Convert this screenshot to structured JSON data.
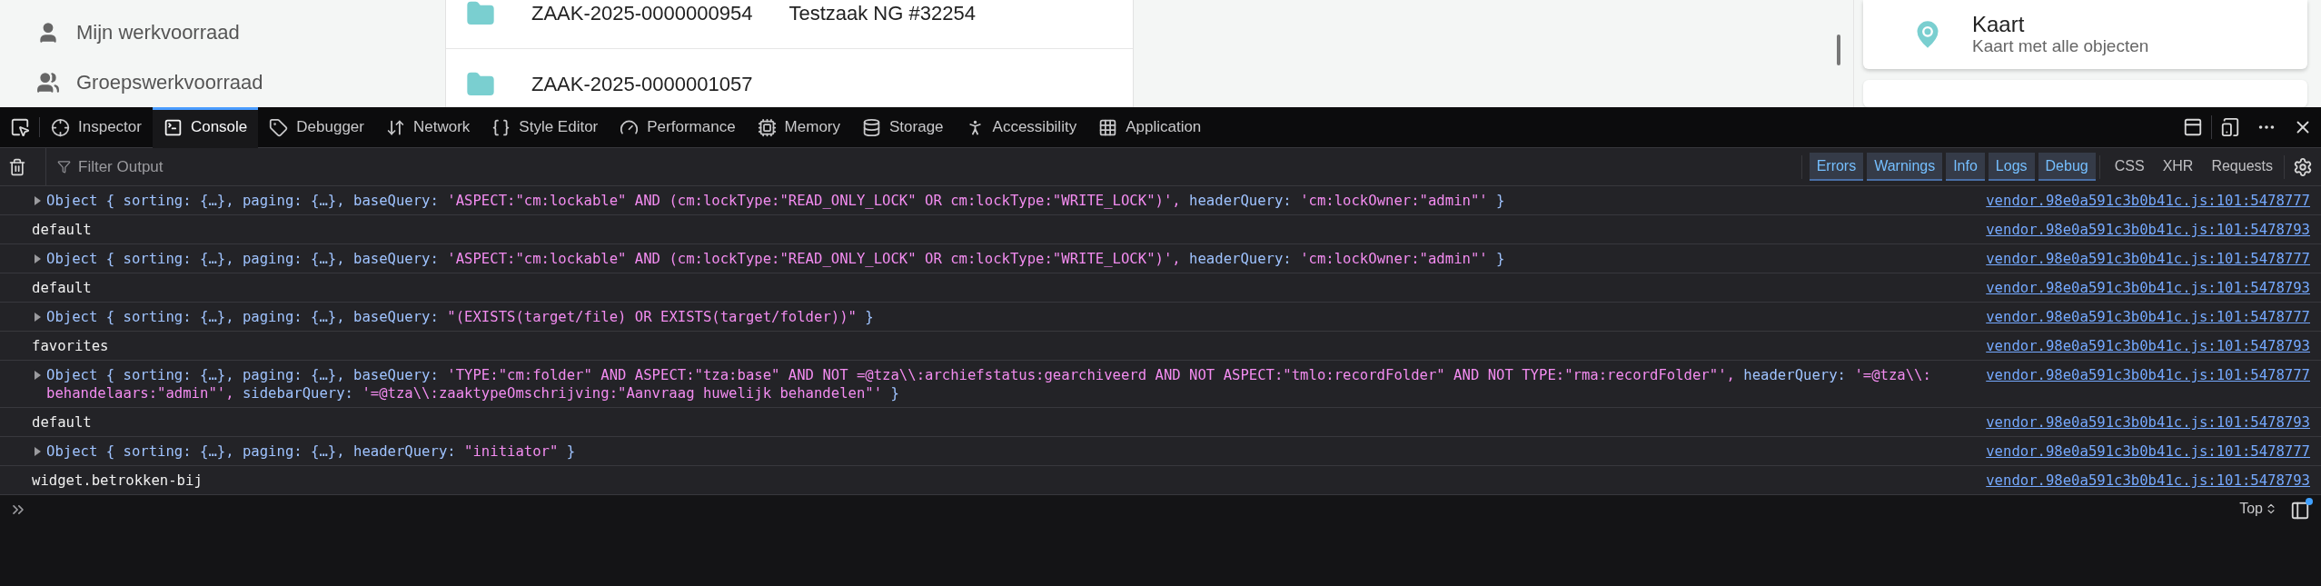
{
  "sidebar": {
    "items": [
      {
        "label": "Mijn werkvoorraad"
      },
      {
        "label": "Groepswerkvoorraad"
      }
    ]
  },
  "cases": [
    {
      "number": "ZAAK-2025-0000000954",
      "title": "Testzaak NG #32254"
    },
    {
      "number": "ZAAK-2025-0000001057"
    }
  ],
  "card": {
    "title": "Kaart",
    "subtitle": "Kaart met alle objecten"
  },
  "devtools": {
    "tabs": [
      {
        "label": "Inspector",
        "selected": false
      },
      {
        "label": "Console",
        "selected": true
      },
      {
        "label": "Debugger",
        "selected": false
      },
      {
        "label": "Network",
        "selected": false
      },
      {
        "label": "Style Editor",
        "selected": false
      },
      {
        "label": "Performance",
        "selected": false
      },
      {
        "label": "Memory",
        "selected": false
      },
      {
        "label": "Storage",
        "selected": false
      },
      {
        "label": "Accessibility",
        "selected": false
      },
      {
        "label": "Application",
        "selected": false
      }
    ],
    "filter": {
      "placeholder": "Filter Output"
    },
    "levels": [
      {
        "label": "Errors",
        "selected": true
      },
      {
        "label": "Warnings",
        "selected": true
      },
      {
        "label": "Info",
        "selected": true
      },
      {
        "label": "Logs",
        "selected": true
      },
      {
        "label": "Debug",
        "selected": true
      }
    ],
    "categories": [
      {
        "label": "CSS",
        "selected": false
      },
      {
        "label": "XHR",
        "selected": false
      },
      {
        "label": "Requests",
        "selected": false
      }
    ],
    "messages": [
      {
        "kind": "object",
        "open": "Object {",
        "props": [
          {
            "key": "sorting:",
            "value": "{…},",
            "kind": "ref"
          },
          {
            "key": "paging:",
            "value": "{…},",
            "kind": "ref"
          },
          {
            "key": "baseQuery:",
            "value": "'ASPECT:\"cm:lockable\" AND (cm:lockType:\"READ_ONLY_LOCK\" OR cm:lockType:\"WRITE_LOCK\")',",
            "kind": "string"
          },
          {
            "key": "headerQuery:",
            "value": "'cm:lockOwner:\"admin\"'",
            "kind": "string"
          }
        ],
        "close": "}",
        "source": "vendor.98e0a591c3b0b41c.js:101:5478777"
      },
      {
        "kind": "text",
        "text": "default",
        "source": "vendor.98e0a591c3b0b41c.js:101:5478793"
      },
      {
        "kind": "object",
        "open": "Object {",
        "props": [
          {
            "key": "sorting:",
            "value": "{…},",
            "kind": "ref"
          },
          {
            "key": "paging:",
            "value": "{…},",
            "kind": "ref"
          },
          {
            "key": "baseQuery:",
            "value": "'ASPECT:\"cm:lockable\" AND (cm:lockType:\"READ_ONLY_LOCK\" OR cm:lockType:\"WRITE_LOCK\")',",
            "kind": "string"
          },
          {
            "key": "headerQuery:",
            "value": "'cm:lockOwner:\"admin\"'",
            "kind": "string"
          }
        ],
        "close": "}",
        "source": "vendor.98e0a591c3b0b41c.js:101:5478777"
      },
      {
        "kind": "text",
        "text": "default",
        "source": "vendor.98e0a591c3b0b41c.js:101:5478793"
      },
      {
        "kind": "object",
        "open": "Object {",
        "props": [
          {
            "key": "sorting:",
            "value": "{…},",
            "kind": "ref"
          },
          {
            "key": "paging:",
            "value": "{…},",
            "kind": "ref"
          },
          {
            "key": "baseQuery:",
            "value": "\"(EXISTS(target/file) OR EXISTS(target/folder))\"",
            "kind": "string"
          }
        ],
        "close": "}",
        "source": "vendor.98e0a591c3b0b41c.js:101:5478777"
      },
      {
        "kind": "text",
        "text": "favorites",
        "source": "vendor.98e0a591c3b0b41c.js:101:5478793"
      },
      {
        "kind": "object",
        "open": "Object {",
        "props": [
          {
            "key": "sorting:",
            "value": "{…},",
            "kind": "ref"
          },
          {
            "key": "paging:",
            "value": "{…},",
            "kind": "ref"
          },
          {
            "key": "baseQuery:",
            "value": "'TYPE:\"cm:folder\" AND ASPECT:\"tza:base\" AND NOT =@tza\\\\:archiefstatus:gearchiveerd AND NOT ASPECT:\"tmlo:recordFolder\" AND NOT TYPE:\"rma:recordFolder\"',",
            "kind": "string"
          },
          {
            "key": "headerQuery:",
            "value": "'=@tza\\\\:behandelaars:\"admin\"',",
            "kind": "string"
          },
          {
            "key": "sidebarQuery:",
            "value": "'=@tza\\\\:zaaktypeOmschrijving:\"Aanvraag huwelijk behandelen\"'",
            "kind": "string"
          }
        ],
        "close": "}",
        "source": "vendor.98e0a591c3b0b41c.js:101:5478777"
      },
      {
        "kind": "text",
        "text": "default",
        "source": "vendor.98e0a591c3b0b41c.js:101:5478793"
      },
      {
        "kind": "object",
        "open": "Object {",
        "props": [
          {
            "key": "sorting:",
            "value": "{…},",
            "kind": "ref"
          },
          {
            "key": "paging:",
            "value": "{…},",
            "kind": "ref"
          },
          {
            "key": "headerQuery:",
            "value": "\"initiator\"",
            "kind": "string"
          }
        ],
        "close": "}",
        "source": "vendor.98e0a591c3b0b41c.js:101:5478777"
      },
      {
        "kind": "text",
        "text": "widget.betrokken-bij",
        "source": "vendor.98e0a591c3b0b41c.js:101:5478793"
      }
    ],
    "context": {
      "label": "Top"
    }
  }
}
